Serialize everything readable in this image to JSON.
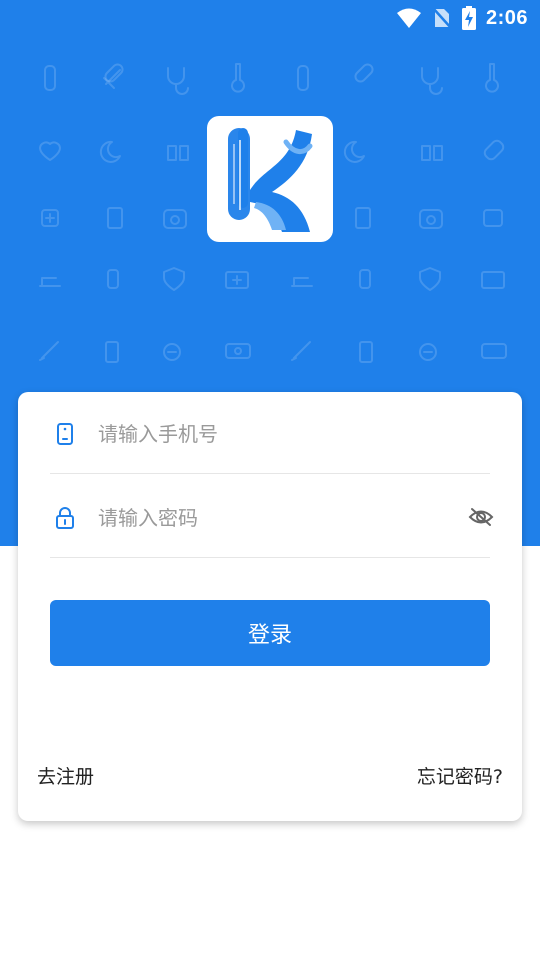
{
  "status_bar": {
    "time": "2:06",
    "icons": [
      "wifi-icon",
      "no-sim-icon",
      "battery-charging-icon"
    ]
  },
  "logo": {
    "icon": "app-logo-k",
    "colors": [
      "#1f80ea",
      "#6fb2f5"
    ]
  },
  "login_form": {
    "phone": {
      "placeholder": "请输入手机号",
      "icon": "phone-icon"
    },
    "password": {
      "placeholder": "请输入密码",
      "icon": "lock-icon",
      "toggle_icon": "eye-off-icon"
    },
    "submit_label": "登录"
  },
  "links": {
    "register": "去注册",
    "forgot_password": "忘记密码?"
  },
  "colors": {
    "primary": "#1f80ea",
    "background": "#ffffff"
  }
}
